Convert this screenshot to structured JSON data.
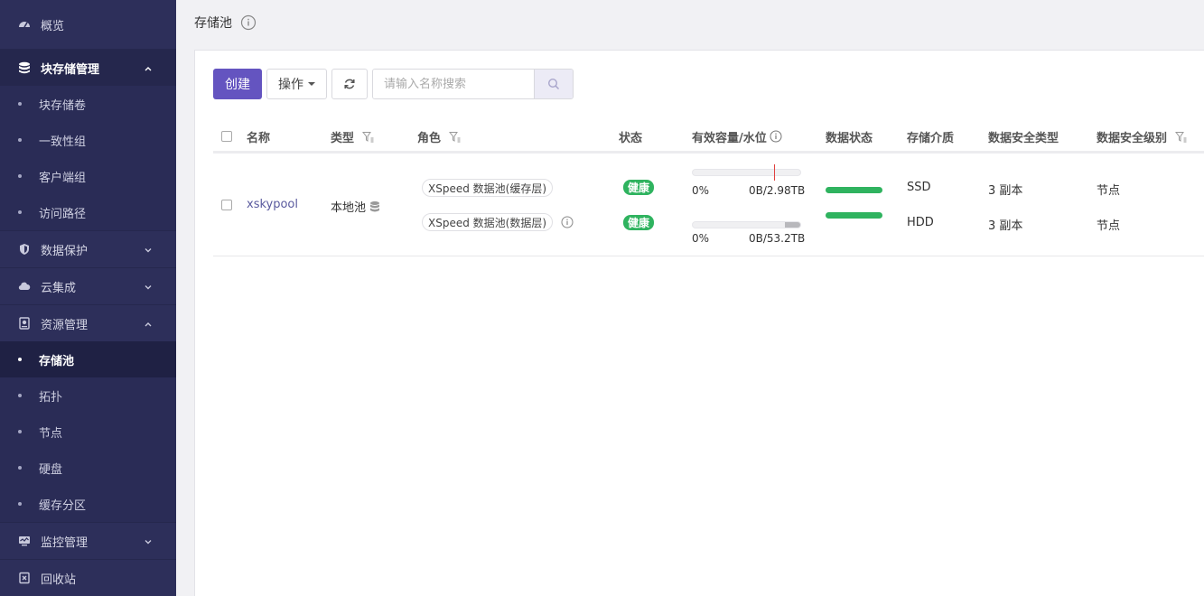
{
  "sidebar": {
    "overview": {
      "label": "概览",
      "icon": "dashboard-icon"
    },
    "groups": [
      {
        "label": "块存储管理",
        "icon": "database-icon",
        "open": true,
        "items": [
          "块存储卷",
          "一致性组",
          "客户端组",
          "访问路径"
        ]
      },
      {
        "label": "数据保护",
        "icon": "shield-icon",
        "open": false
      },
      {
        "label": "云集成",
        "icon": "cloud-icon",
        "open": false
      },
      {
        "label": "资源管理",
        "icon": "disk-icon",
        "open": true,
        "items": [
          "存储池",
          "拓扑",
          "节点",
          "硬盘",
          "缓存分区"
        ],
        "active": "存储池"
      },
      {
        "label": "监控管理",
        "icon": "monitor-icon",
        "open": false
      },
      {
        "label": "回收站",
        "icon": "recycle-icon",
        "open": false
      }
    ]
  },
  "page": {
    "title": "存储池"
  },
  "toolbar": {
    "create_label": "创建",
    "operate_label": "操作",
    "search_placeholder": "请输入名称搜索"
  },
  "table": {
    "headers": {
      "name": "名称",
      "type": "类型",
      "role": "角色",
      "status": "状态",
      "capacity": "有效容量/水位",
      "data_status": "数据状态",
      "media": "存储介质",
      "security_type": "数据安全类型",
      "security_level": "数据安全级别"
    },
    "rows": [
      {
        "name": "xskypool",
        "type": "本地池",
        "layers": [
          {
            "role": "XSpeed 数据池(缓存层)",
            "status": "健康",
            "cap_percent": "0%",
            "cap_text": "0B/2.98TB",
            "fill": 0,
            "watermark": 0.75,
            "media": "SSD",
            "security_type": "3 副本",
            "security_level": "节点"
          },
          {
            "role": "XSpeed 数据池(数据层)",
            "status": "健康",
            "cap_percent": "0%",
            "cap_text": "0B/53.2TB",
            "fill": 0.14,
            "media": "HDD",
            "security_type": "3 副本",
            "security_level": "节点"
          }
        ]
      }
    ]
  },
  "colors": {
    "sidebar_bg": "#2d2f5a",
    "accent": "#6454c0",
    "healthy": "#2fb35f",
    "watermark": "#e0413f"
  }
}
